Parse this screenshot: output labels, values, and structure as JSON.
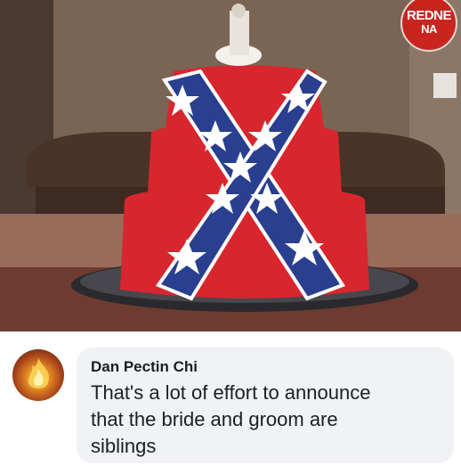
{
  "photo": {
    "alt": "",
    "watermark": {
      "line1": "REDNE",
      "line2": "NA"
    }
  },
  "comment": {
    "author": "Dan Pectin Chi",
    "text_lines": [
      "That's a lot of effort to announce",
      "that the bride and groom are",
      "siblings"
    ]
  },
  "colors": {
    "cake_red": "#d8262e",
    "cake_blue": "#2a3f8f",
    "star_white": "#ffffff",
    "bubble_bg": "#f0f2f5"
  },
  "icons": {
    "avatar": "fire-avatar-icon"
  }
}
